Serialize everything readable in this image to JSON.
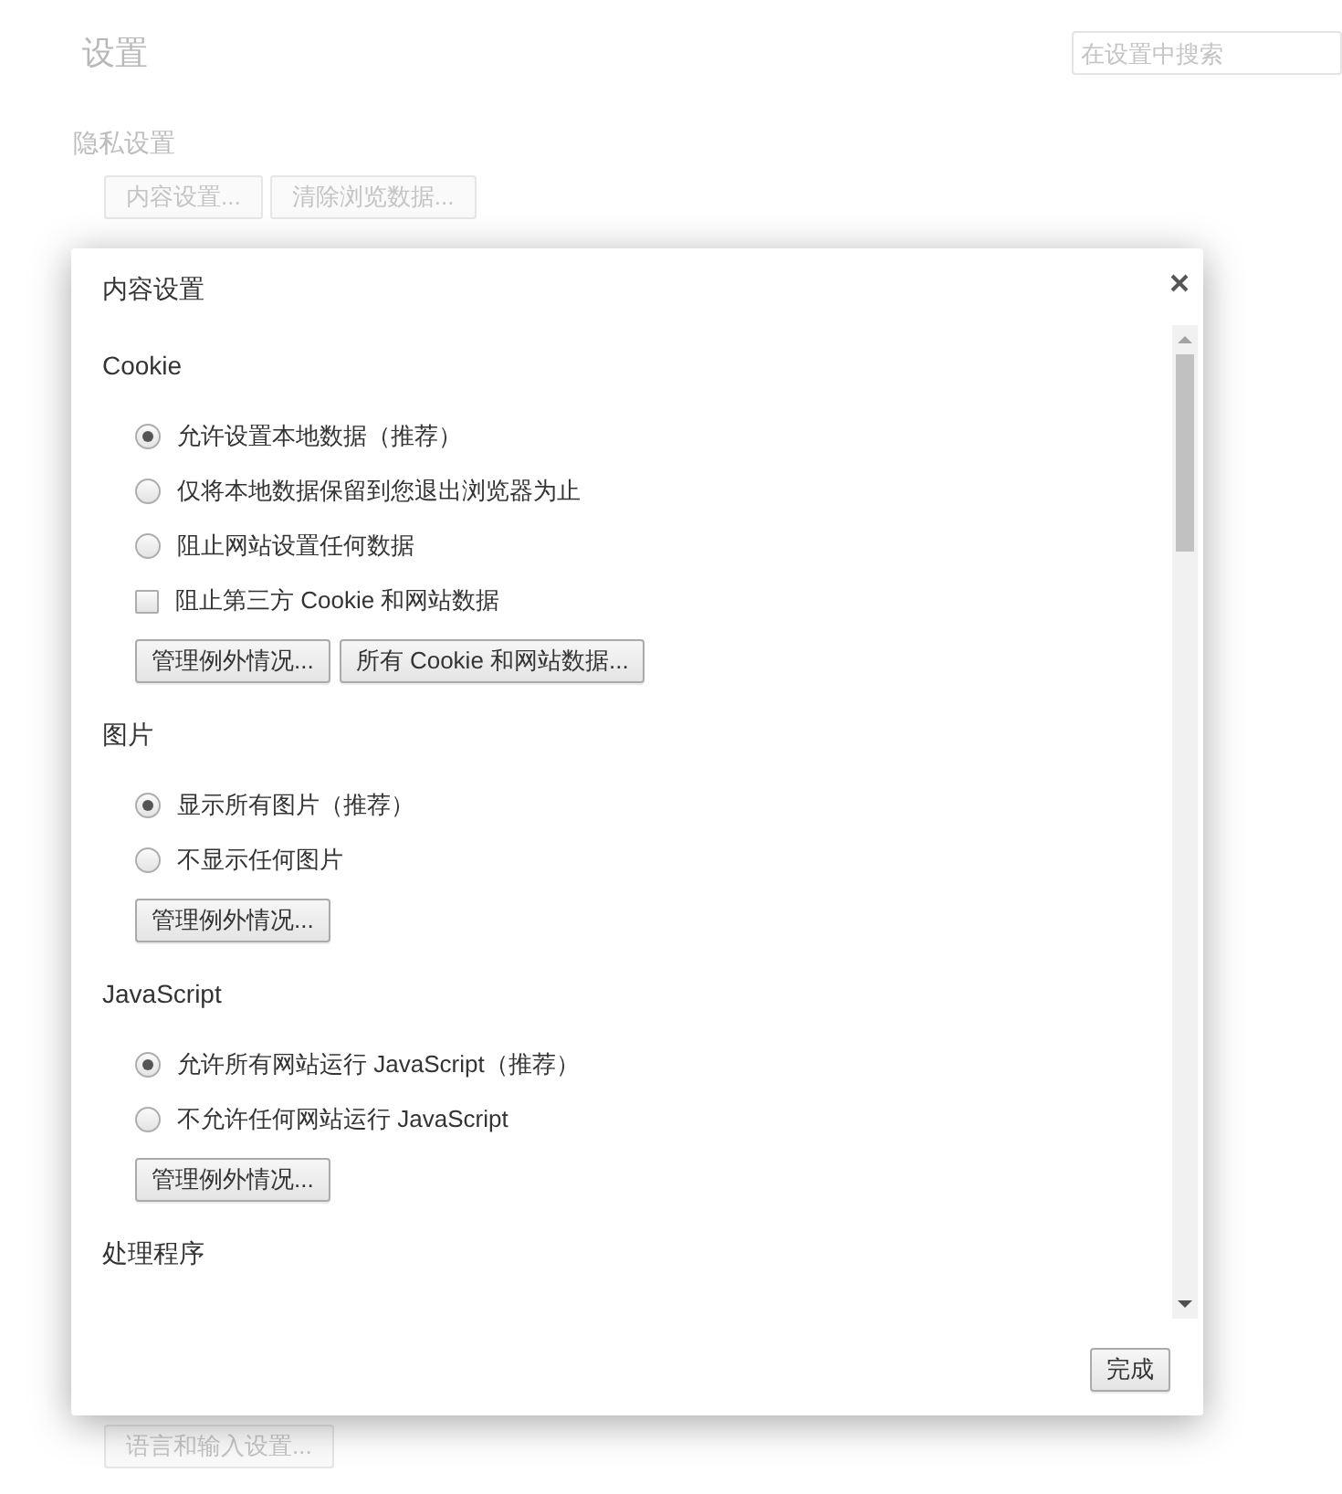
{
  "page": {
    "title": "设置",
    "search": {
      "placeholder": "在设置中搜索"
    },
    "section_title": "隐私设置",
    "buttons": [
      "内容设置...",
      "清除浏览数据..."
    ],
    "bottom_button": "语言和输入设置..."
  },
  "dialog": {
    "title": "内容设置",
    "sections": [
      {
        "heading": "Cookie",
        "options": [
          {
            "kind": "radio",
            "label": "允许设置本地数据（推荐）",
            "selected": true
          },
          {
            "kind": "radio",
            "label": "仅将本地数据保留到您退出浏览器为止",
            "selected": false
          },
          {
            "kind": "radio",
            "label": "阻止网站设置任何数据",
            "selected": false
          },
          {
            "kind": "checkbox",
            "label": "阻止第三方 Cookie 和网站数据",
            "checked": false
          }
        ],
        "buttons": [
          "管理例外情况...",
          "所有 Cookie 和网站数据..."
        ]
      },
      {
        "heading": "图片",
        "options": [
          {
            "kind": "radio",
            "label": "显示所有图片（推荐）",
            "selected": true
          },
          {
            "kind": "radio",
            "label": "不显示任何图片",
            "selected": false
          }
        ],
        "buttons": [
          "管理例外情况..."
        ]
      },
      {
        "heading": "JavaScript",
        "options": [
          {
            "kind": "radio",
            "label": "允许所有网站运行 JavaScript（推荐）",
            "selected": true
          },
          {
            "kind": "radio",
            "label": "不允许任何网站运行 JavaScript",
            "selected": false
          }
        ],
        "buttons": [
          "管理例外情况..."
        ]
      },
      {
        "heading": "处理程序"
      }
    ],
    "done_button": "完成"
  }
}
